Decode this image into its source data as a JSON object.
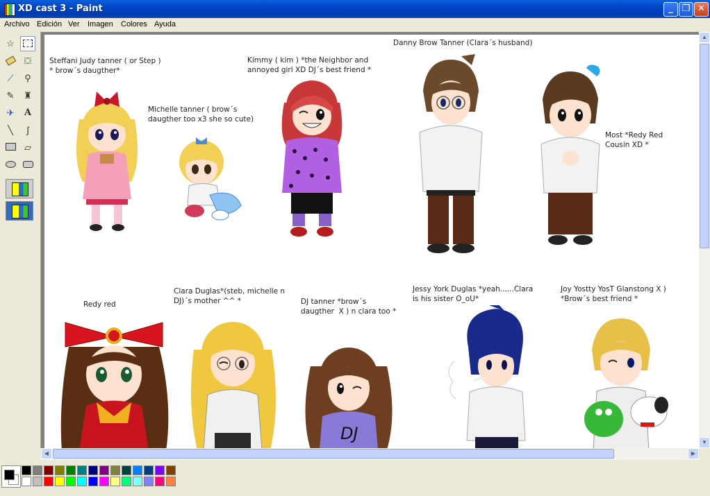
{
  "window": {
    "title": "XD cast 3 - Paint"
  },
  "menu": [
    "Archivo",
    "Edición",
    "Ver",
    "Imagen",
    "Colores",
    "Ayuda"
  ],
  "tools": [
    "free-select",
    "rect-select",
    "eraser",
    "fill",
    "color-picker",
    "magnifier",
    "pencil",
    "brush",
    "airbrush",
    "text",
    "line",
    "curve",
    "rectangle",
    "polygon",
    "ellipse",
    "rounded-rectangle"
  ],
  "captions": {
    "steffani": "Steffani Judy tanner ( or Step )\n* brow´s daugther*",
    "michelle": "Michelle tanner ( brow´s\ndaugther too x3 she so cute)",
    "kimmy": "Kimmy ( kim ) *the Neighbor and\nannoyed girl XD DJ´s best friend *",
    "danny": "Danny Brow Tanner (Clara´s husband)",
    "most": "Most *Redy Red\nCousin XD *",
    "redy": "Redy red",
    "clara": "Clara Duglas*(steb, michelle n\nDJ)´s mother ^^ *",
    "dj": "DJ tanner *brow´s\ndaugther  X ) n clara too *",
    "jessy": "Jessy York Duglas *yeah......Clara\nis his sister O_oU*",
    "joy": "Joy Yostty YosT Glanstong X )\n*Brow´s best friend *"
  },
  "shirt_text": "DJ",
  "palette": {
    "row1": [
      "#000000",
      "#808080",
      "#800000",
      "#808000",
      "#008000",
      "#008080",
      "#000080",
      "#800080",
      "#808040",
      "#004040",
      "#0080ff",
      "#004080",
      "#8000ff",
      "#804000"
    ],
    "row2": [
      "#ffffff",
      "#c0c0c0",
      "#ff0000",
      "#ffff00",
      "#00ff00",
      "#00ffff",
      "#0000ff",
      "#ff00ff",
      "#ffff80",
      "#00ff80",
      "#80ffff",
      "#8080ff",
      "#ff0080",
      "#ff8040"
    ],
    "foreground": "#000000",
    "background": "#ffffff"
  }
}
